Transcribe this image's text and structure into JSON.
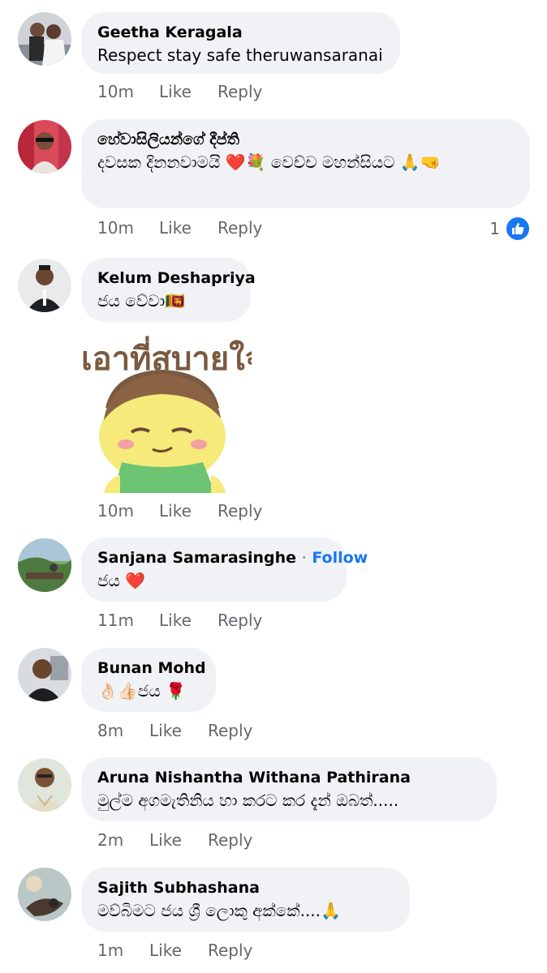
{
  "comments": [
    {
      "author": "Geetha Keragala",
      "text": "Respect stay safe theruwansaranai",
      "time": "10m",
      "like": "Like",
      "reply": "Reply"
    },
    {
      "author": "හේවාසිලියන්ගේ දීප්ති",
      "text": "දවසක දිනනවාමයි ❤️💐 වෙච්ච මහන්සියට 🙏🤜",
      "time": "10m",
      "like": "Like",
      "reply": "Reply",
      "reaction_count": "1"
    },
    {
      "author": "Kelum Deshapriya",
      "text": "ජය වේවා🇱🇰",
      "time": "10m",
      "like": "Like",
      "reply": "Reply",
      "sticker_text": "เอาที่สบายใจ"
    },
    {
      "author": "Sanjana Samarasinghe",
      "follow": "Follow",
      "separator": "·",
      "text": "ජය ❤️",
      "time": "11m",
      "like": "Like",
      "reply": "Reply"
    },
    {
      "author": "Bunan Mohd",
      "text": "👌🏻👍🏻ජය 🌹",
      "time": "8m",
      "like": "Like",
      "reply": "Reply"
    },
    {
      "author": "Aruna Nishantha Withana Pathirana",
      "text": "මුල්ම අගමැතිනිය හා කරට කර දැන් ඔබත්.....",
      "time": "2m",
      "like": "Like",
      "reply": "Reply"
    },
    {
      "author": "Sajith Subhashana",
      "text": "මව්බිමට ජය ශ්‍රී ලොකු අක්කේ....🙏",
      "time": "1m",
      "like": "Like",
      "reply": "Reply"
    }
  ],
  "colors": {
    "accent": "#1877f2",
    "bubble": "#f0f2f5",
    "meta": "#65676b"
  },
  "icons": {
    "reaction": "like-thumb-icon"
  }
}
